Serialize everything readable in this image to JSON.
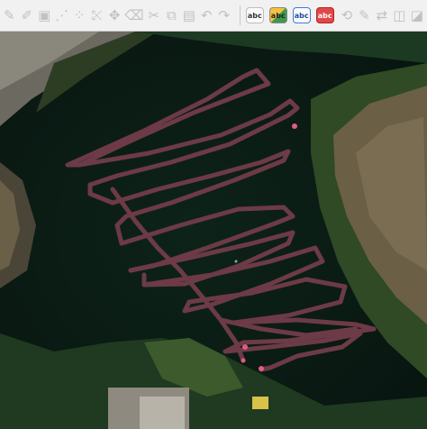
{
  "toolbar": {
    "buttons": [
      {
        "name": "pencil-icon",
        "glyph": "✎"
      },
      {
        "name": "edit-pencil-icon",
        "glyph": "✐"
      },
      {
        "name": "save-edits-icon",
        "glyph": "▣"
      },
      {
        "name": "add-feature-icon",
        "glyph": "⋰"
      },
      {
        "name": "node-tool-icon",
        "glyph": "⁘"
      },
      {
        "name": "vertex-edit-icon",
        "glyph": "⤪"
      },
      {
        "name": "move-feature-icon",
        "glyph": "✥"
      },
      {
        "name": "delete-icon",
        "glyph": "🗑"
      },
      {
        "name": "cut-icon",
        "glyph": "✂"
      },
      {
        "name": "copy-icon",
        "glyph": "⧉"
      },
      {
        "name": "paste-icon",
        "glyph": "📋"
      },
      {
        "name": "undo-icon",
        "glyph": "↶"
      },
      {
        "name": "redo-icon",
        "glyph": "↷"
      }
    ],
    "label_buttons": [
      {
        "name": "label-toggle-button",
        "text": "abc",
        "style": "plain"
      },
      {
        "name": "label-style-button",
        "text": "abc",
        "style": "blue"
      },
      {
        "name": "label-pin-button",
        "text": "abc",
        "style": "blue"
      },
      {
        "name": "label-remove-button",
        "text": "abc",
        "style": "red"
      }
    ],
    "extra_icons": [
      "label-rotate-icon",
      "label-change-icon",
      "label-move-icon",
      "label-show-icon",
      "label-hide-icon"
    ]
  },
  "map": {
    "track_color": "#6d3a47",
    "point_color": "#e25d7f"
  }
}
